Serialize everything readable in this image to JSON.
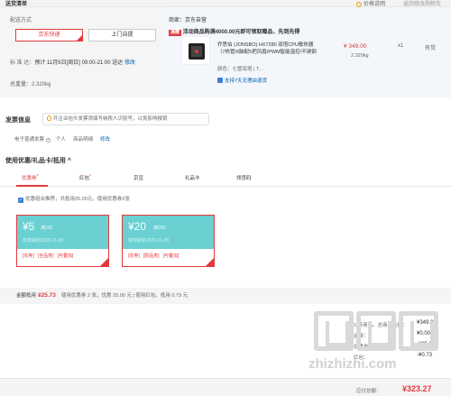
{
  "top": {
    "title": "送货清单",
    "help": "价格说明",
    "back": "返回修改购物车"
  },
  "shipping": {
    "method_label": "配送方式",
    "options": [
      "京东快递",
      "上门自提"
    ],
    "time_label": "标 准 达：",
    "time_value": "预计 11月5日[周日] 09:00-21:00 送达",
    "modify": "修改",
    "weight_label": "总重量：",
    "weight": "2.320kg"
  },
  "product": {
    "seller_label": "商家：",
    "seller": "京东自营",
    "promo_tag": "满赠",
    "promo_text": "活动商品购满4000.00元即可领取赠品，先到先得",
    "name": "乔思伯 (JONSBO) HX7280 双塔CPU散热器（7热管/6脑配5把风扇/PWM智能温控/不锈钢",
    "color_label": "颜色：",
    "color": "七管双塔 | T...",
    "support": "支持7天无理由退货",
    "price": "¥ 349.00",
    "weight": "2.320kg",
    "qty": "x1",
    "stock": "有货"
  },
  "invoice": {
    "title": "发票信息",
    "tip": "开企业抬头发票须填写纳税人识别号，以免影响报销",
    "type": "电子普通发票",
    "q": "?",
    "personal": "个人",
    "detail": "商品明细",
    "modify": "修改"
  },
  "coupons": {
    "title": "使用优惠/礼品卡/抵用",
    "tabs": [
      {
        "label": "优惠券",
        "star": "*"
      },
      {
        "label": "红包",
        "star": "*"
      },
      {
        "label": "京豆",
        "star": ""
      },
      {
        "label": "礼品卡",
        "star": ""
      },
      {
        "label": "领货码",
        "star": ""
      }
    ],
    "checkbox": "优惠组合推荐，共抵用25.00元，使用优惠券2张",
    "cards": [
      {
        "amount": "¥5",
        "cond": "满105",
        "date": "有效期至2023-11-03",
        "tags": [
          "[东券]",
          "[全品类]",
          "[可叠加]"
        ]
      },
      {
        "amount": "¥20",
        "cond": "满200",
        "date": "有效期至2023-11-03",
        "tags": [
          "[东券]",
          "[限品类]",
          "[可叠加]"
        ]
      }
    ],
    "summary_label": "金额抵用",
    "summary_amount": "¥25.73",
    "summary_detail": "使用优惠券 2 张，优惠 25.00 元 | 使用红包，抵用 0.73 元"
  },
  "totals": {
    "rows": [
      {
        "label": "1 件商品，总商品金额：",
        "value": "¥349.00"
      },
      {
        "label": "运费：",
        "value": "¥0.00"
      },
      {
        "label": "优惠券：",
        "value": "-¥25.00"
      },
      {
        "label": "红包：",
        "value": "-¥0.73"
      }
    ],
    "payable_label": "应付总额：",
    "payable": "¥323.27"
  },
  "watermark": {
    "site": "zhizhizhi.com"
  },
  "colors": {
    "accent": "#e4393c",
    "link": "#005ea7",
    "coupon": "#6ad0d2"
  }
}
